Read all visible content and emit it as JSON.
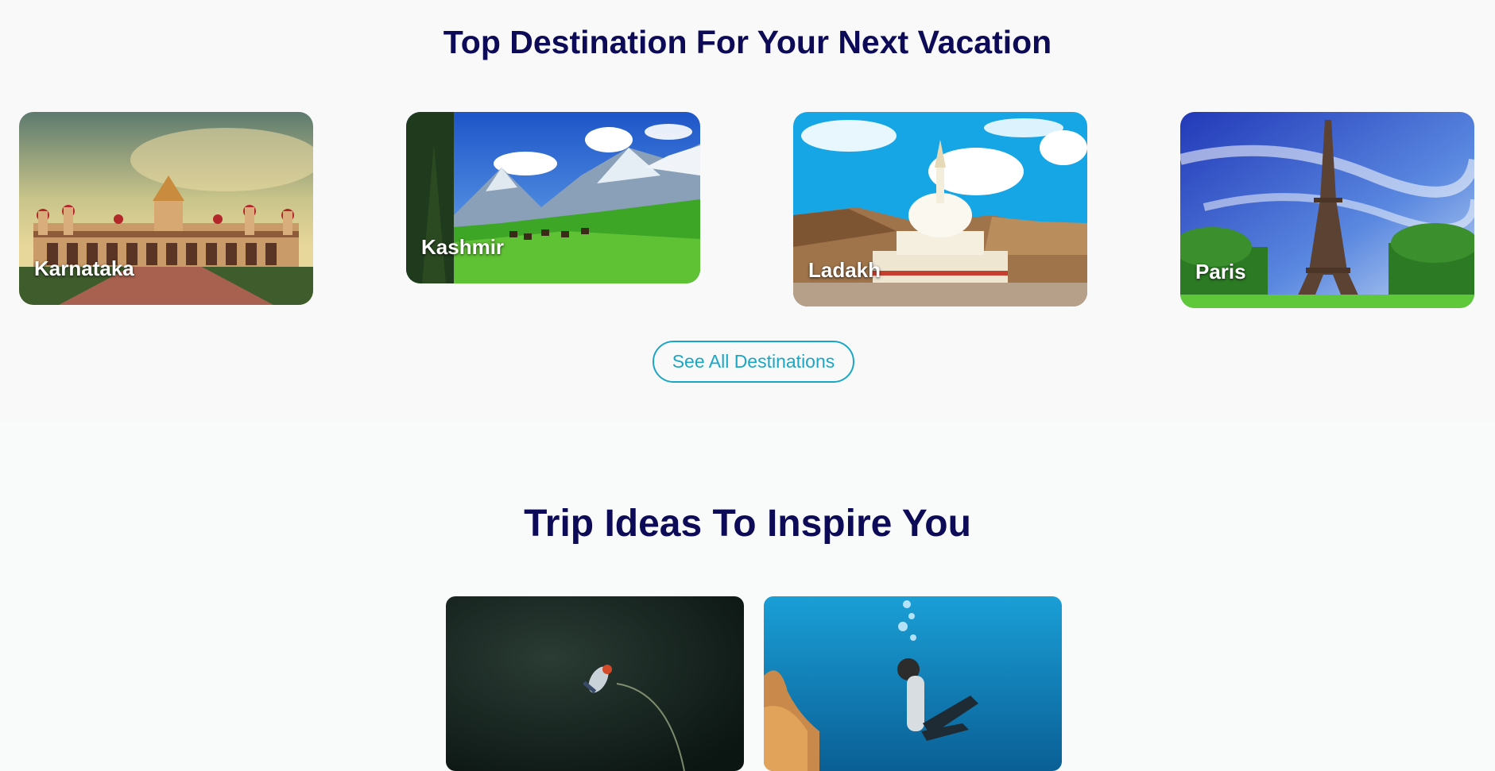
{
  "destinations": {
    "title": "Top Destination For Your Next Vacation",
    "cards": [
      {
        "label": "Karnataka"
      },
      {
        "label": "Kashmir"
      },
      {
        "label": "Ladakh"
      },
      {
        "label": "Paris"
      }
    ],
    "see_all_label": "See All Destinations"
  },
  "trip_ideas": {
    "title": "Trip Ideas To Inspire You",
    "cards": [
      {
        "image": "rappelling-waterfall-photo"
      },
      {
        "image": "scuba-diver-photo"
      }
    ]
  },
  "colors": {
    "heading": "#0d0b57",
    "accent": "#1ba7c4",
    "section_bg": "#f9f9f9"
  }
}
